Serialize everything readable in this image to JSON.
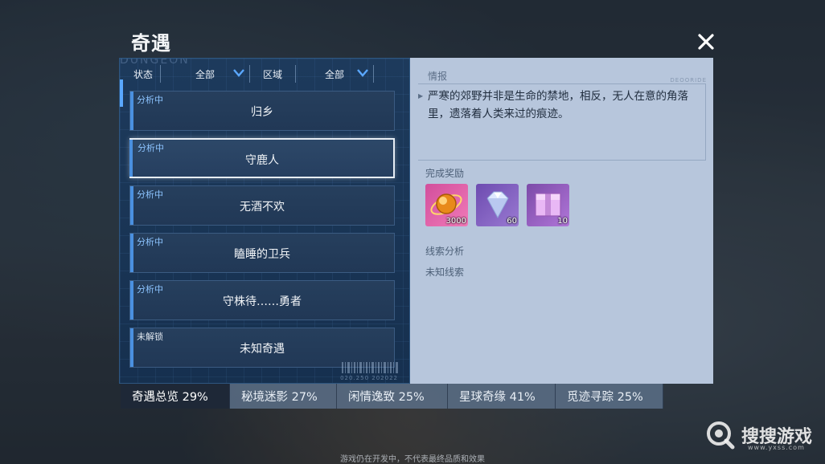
{
  "page": {
    "title": "奇遇",
    "close_icon": "close-icon"
  },
  "left_panel": {
    "watermark": "DUNGEON",
    "filters": [
      {
        "label": "状态",
        "value": "全部"
      },
      {
        "label": "区域",
        "value": "全部"
      }
    ],
    "items": [
      {
        "status": "分析中",
        "name": "归乡",
        "selected": false
      },
      {
        "status": "分析中",
        "name": "守鹿人",
        "selected": true
      },
      {
        "status": "分析中",
        "name": "无酒不欢",
        "selected": false
      },
      {
        "status": "分析中",
        "name": "瞌睡的卫兵",
        "selected": false
      },
      {
        "status": "分析中",
        "name": "守株待……勇者",
        "selected": false
      },
      {
        "status": "未解锁",
        "name": "未知奇遇",
        "selected": false
      }
    ],
    "barcode_text": "020.250 202022"
  },
  "right_panel": {
    "intel_label": "情报",
    "tiny_code": "DEOORIDE",
    "intel_text": "严寒的郊野并非是生命的禁地，相反，无人在意的角落里，遗落着人类来过的痕迹。",
    "reward_label": "完成奖励",
    "rewards": [
      {
        "icon": "orb-icon",
        "count": "3000"
      },
      {
        "icon": "diamond-icon",
        "count": "60"
      },
      {
        "icon": "crate-icon",
        "count": "10"
      }
    ],
    "clue_label": "线索分析",
    "clue_value": "未知线索"
  },
  "tabs": [
    {
      "label": "奇遇总览 29%",
      "active": true
    },
    {
      "label": "秘境迷影 27%",
      "active": false
    },
    {
      "label": "闲情逸致 25%",
      "active": false
    },
    {
      "label": "星球奇缘 41%",
      "active": false
    },
    {
      "label": "觅迹寻踪 25%",
      "active": false
    }
  ],
  "footer_note": "游戏仍在开发中，不代表最终品质和效果",
  "watermark_logo": {
    "text": "搜搜游戏",
    "url": "www.yxss.com"
  },
  "colors": {
    "panel_dark": "#1d3a5c",
    "panel_light": "#b7c6dc",
    "accent_blue": "#4a90e0",
    "status_blue": "#8cc4ff"
  }
}
